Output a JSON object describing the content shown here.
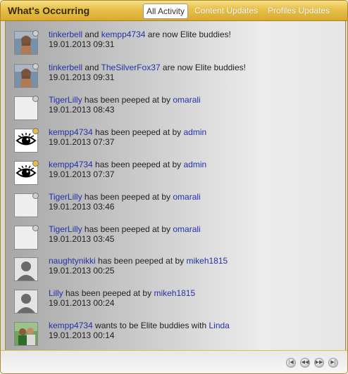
{
  "header": {
    "title": "What's Occurring",
    "tabs": [
      "All Activity",
      "Content Updates",
      "Profiles Updates"
    ]
  },
  "colors": {
    "link": "#2232a8",
    "status_online": "#e8c03a",
    "status_offline": "#d0d0d0",
    "accent_gold": "#d9a92e"
  },
  "activities": [
    {
      "avatar": "woman-photo",
      "status": "offline",
      "actor": "tinkerbell",
      "connector": " and ",
      "target": "kempp4734",
      "text": " are now Elite buddies!",
      "timestamp": "19.01.2013 09:31"
    },
    {
      "avatar": "woman-photo",
      "status": "offline",
      "actor": "tinkerbell",
      "connector": " and ",
      "target": "TheSilverFox37",
      "text": " are now Elite buddies!",
      "timestamp": "19.01.2013 09:31"
    },
    {
      "avatar": "blank",
      "status": "offline",
      "actor": "TigerLilly",
      "connector": " has been peeped at by ",
      "target": "omarali",
      "text": "",
      "timestamp": "19.01.2013 08:43"
    },
    {
      "avatar": "eye",
      "status": "online",
      "actor": "kempp4734",
      "connector": " has been peeped at by ",
      "target": "admin",
      "text": "",
      "timestamp": "19.01.2013 07:37"
    },
    {
      "avatar": "eye",
      "status": "online",
      "actor": "kempp4734",
      "connector": " has been peeped at by ",
      "target": "admin",
      "text": "",
      "timestamp": "19.01.2013 07:37"
    },
    {
      "avatar": "blank",
      "status": "offline",
      "actor": "TigerLilly",
      "connector": " has been peeped at by ",
      "target": "omarali",
      "text": "",
      "timestamp": "19.01.2013 03:46"
    },
    {
      "avatar": "blank",
      "status": "offline",
      "actor": "TigerLilly",
      "connector": " has been peeped at by ",
      "target": "omarali",
      "text": "",
      "timestamp": "19.01.2013 03:45"
    },
    {
      "avatar": "silhouette",
      "status": "none",
      "actor": "naughtynikki",
      "connector": " has been peeped at by ",
      "target": "mikeh1815",
      "text": "",
      "timestamp": "19.01.2013 00:25"
    },
    {
      "avatar": "silhouette",
      "status": "none",
      "actor": "Lilly",
      "connector": " has been peeped at by ",
      "target": "mikeh1815",
      "text": "",
      "timestamp": "19.01.2013 00:24"
    },
    {
      "avatar": "men-photo",
      "status": "none",
      "actor": "kempp4734",
      "connector": " wants to be Elite buddies with ",
      "target": "Linda",
      "text": "",
      "timestamp": "19.01.2013 00:14"
    }
  ],
  "pager": [
    "first-page-icon",
    "previous-page-icon",
    "next-page-icon",
    "last-page-icon"
  ]
}
